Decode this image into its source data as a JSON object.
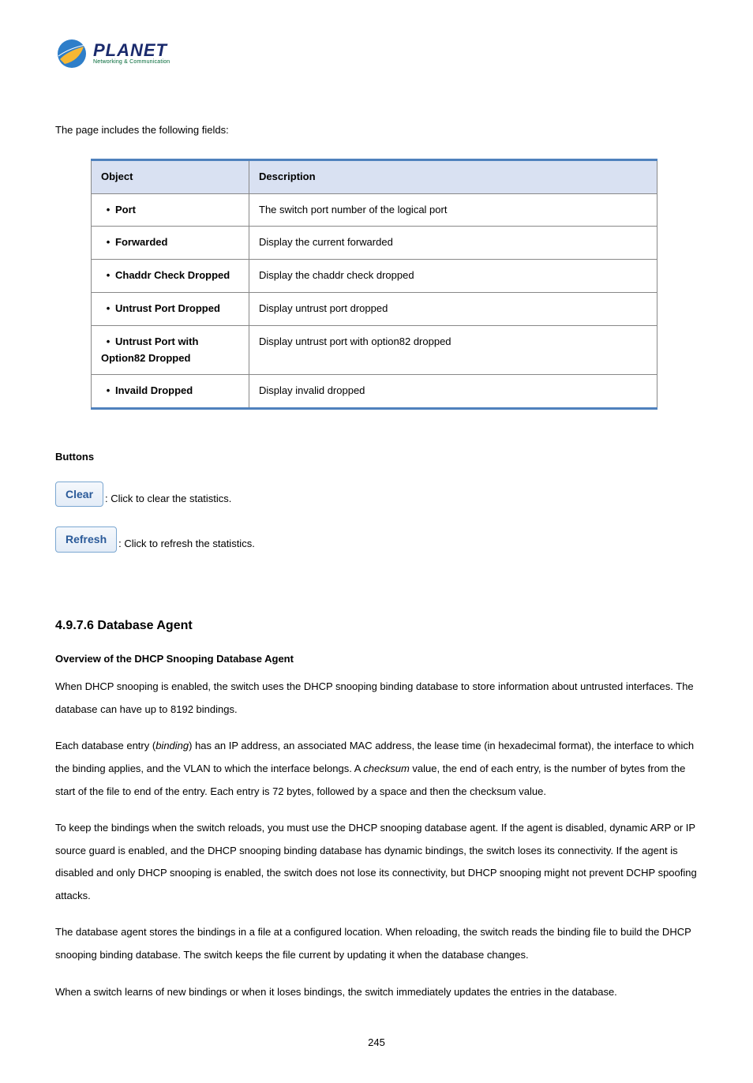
{
  "logo": {
    "brand": "PLANET",
    "tagline": "Networking & Communication"
  },
  "intro": "The page includes the following fields:",
  "table": {
    "headers": {
      "object": "Object",
      "description": "Description"
    },
    "rows": [
      {
        "object": "Port",
        "description": "The switch port number of the logical port"
      },
      {
        "object": "Forwarded",
        "description": "Display the current forwarded"
      },
      {
        "object": "Chaddr Check Dropped",
        "description": "Display the chaddr check dropped"
      },
      {
        "object": "Untrust Port Dropped",
        "description": "Display untrust port dropped"
      },
      {
        "object": "Untrust Port with Option82 Dropped",
        "description": "Display untrust port with option82 dropped"
      },
      {
        "object": "Invaild Dropped",
        "description": "Display invalid dropped"
      }
    ]
  },
  "buttons": {
    "heading": "Buttons",
    "clear": {
      "label": "Clear",
      "desc": ": Click to clear the statistics."
    },
    "refresh": {
      "label": "Refresh",
      "desc": ": Click to refresh the statistics."
    }
  },
  "section": {
    "title": "4.9.7.6 Database Agent",
    "overview_heading": "Overview of the DHCP Snooping Database Agent",
    "p1": "When DHCP snooping is enabled, the switch uses the DHCP snooping binding database to store information about untrusted interfaces. The database can have up to 8192 bindings.",
    "p2a": "Each database entry (",
    "p2_italic1": "binding",
    "p2b": ") has an IP address, an associated MAC address, the lease time (in hexadecimal format), the interface to which the binding applies, and the VLAN to which the interface belongs. A ",
    "p2_italic2": "checksum",
    "p2c": " value, the end of each entry, is the number of bytes from the start of the file to end of the entry. Each entry is 72 bytes, followed by a space and then the checksum value.",
    "p3": "To keep the bindings when the switch reloads, you must use the DHCP snooping database agent. If the agent is disabled, dynamic ARP or IP source guard is enabled, and the DHCP snooping binding database has dynamic bindings, the switch loses its connectivity. If the agent is disabled and only DHCP snooping is enabled, the switch does not lose its connectivity, but DHCP snooping might not prevent DCHP spoofing attacks.",
    "p4": "The database agent stores the bindings in a file at a configured location. When reloading, the switch reads the binding file to build the DHCP snooping binding database. The switch keeps the file current by updating it when the database changes.",
    "p5": "When a switch learns of new bindings or when it loses bindings, the switch immediately updates the entries in the database."
  },
  "page_number": "245"
}
